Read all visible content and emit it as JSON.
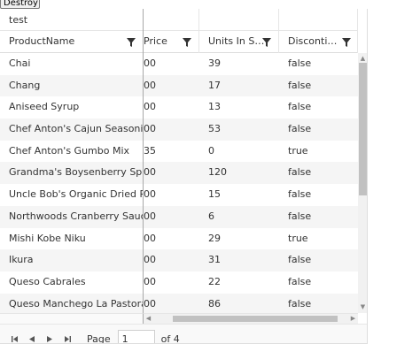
{
  "top_button": {
    "label": "Destroy"
  },
  "grid": {
    "group_header": {
      "label": "test"
    },
    "columns": [
      {
        "label": "ProductName"
      },
      {
        "label": "Price"
      },
      {
        "label": "Units In St..."
      },
      {
        "label": "Discontinued"
      }
    ],
    "rows": [
      {
        "name": "Chai",
        "price": "00",
        "units": "39",
        "discontinued": "false"
      },
      {
        "name": "Chang",
        "price": "00",
        "units": "17",
        "discontinued": "false"
      },
      {
        "name": "Aniseed Syrup",
        "price": "00",
        "units": "13",
        "discontinued": "false"
      },
      {
        "name": "Chef Anton's Cajun Seasoning",
        "price": "00",
        "units": "53",
        "discontinued": "false"
      },
      {
        "name": "Chef Anton's Gumbo Mix",
        "price": "35",
        "units": "0",
        "discontinued": "true"
      },
      {
        "name": "Grandma's Boysenberry Spread",
        "price": "00",
        "units": "120",
        "discontinued": "false"
      },
      {
        "name": "Uncle Bob's Organic Dried Pears",
        "price": "00",
        "units": "15",
        "discontinued": "false"
      },
      {
        "name": "Northwoods Cranberry Sauce",
        "price": "00",
        "units": "6",
        "discontinued": "false"
      },
      {
        "name": "Mishi Kobe Niku",
        "price": "00",
        "units": "29",
        "discontinued": "true"
      },
      {
        "name": "Ikura",
        "price": "00",
        "units": "31",
        "discontinued": "false"
      },
      {
        "name": "Queso Cabrales",
        "price": "00",
        "units": "22",
        "discontinued": "false"
      },
      {
        "name": "Queso Manchego La Pastora",
        "price": "00",
        "units": "86",
        "discontinued": "false"
      }
    ]
  },
  "pager": {
    "page_label": "Page",
    "current_page": "1",
    "of_label": "of 4"
  }
}
